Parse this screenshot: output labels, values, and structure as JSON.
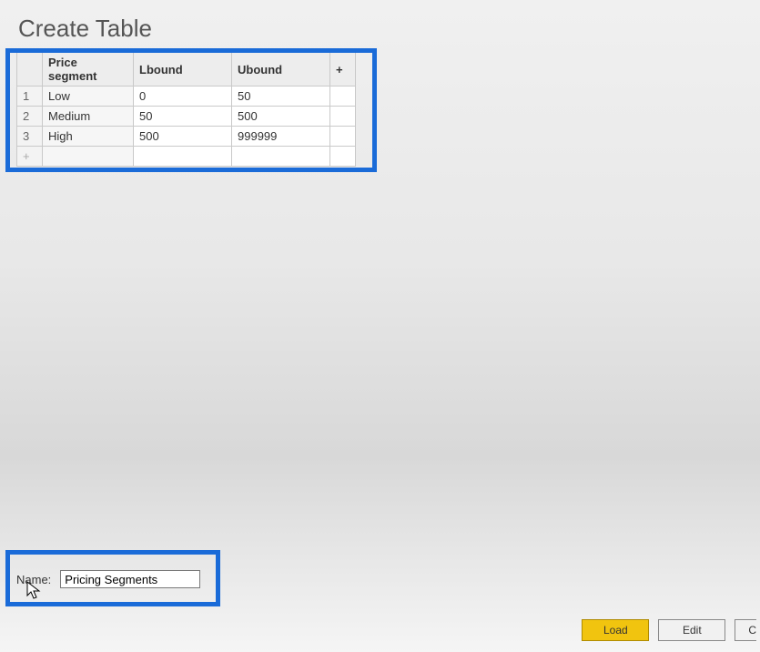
{
  "dialog": {
    "title": "Create Table"
  },
  "table": {
    "headers": {
      "segment": "Price segment",
      "lbound": "Lbound",
      "ubound": "Ubound",
      "add": "+"
    },
    "rows": [
      {
        "idx": "1",
        "segment": "Low",
        "lbound": "0",
        "ubound": "50"
      },
      {
        "idx": "2",
        "segment": "Medium",
        "lbound": "50",
        "ubound": "500"
      },
      {
        "idx": "3",
        "segment": "High",
        "lbound": "500",
        "ubound": "999999"
      }
    ],
    "addrow_label": "+"
  },
  "nameField": {
    "label": "Name:",
    "value": "Pricing Segments"
  },
  "buttons": {
    "load": "Load",
    "edit": "Edit",
    "cancel": "C"
  }
}
